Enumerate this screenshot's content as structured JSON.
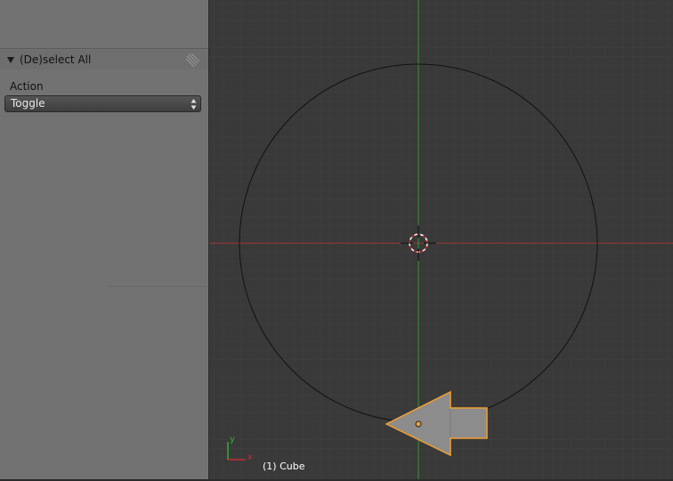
{
  "operator_panel": {
    "title": "(De)select All",
    "action_label": "Action",
    "action_value": "Toggle"
  },
  "viewport": {
    "object_label": "(1) Cube",
    "axis_y_label": "y",
    "axis_x_label": "x",
    "colors": {
      "background": "#393939",
      "x_axis": "#b03a3a",
      "y_axis": "#2fa12f",
      "selection_outline": "#f0a030",
      "object_fill": "#8c8c8c",
      "circle": "#111111"
    }
  },
  "icons": {
    "panel_collapse": "triangle-down-icon",
    "panel_grip": "drag-grip-icon",
    "select_arrows": "up-down-arrows-icon",
    "cursor_3d": "3d-cursor-icon",
    "object_origin": "origin-dot-icon"
  }
}
